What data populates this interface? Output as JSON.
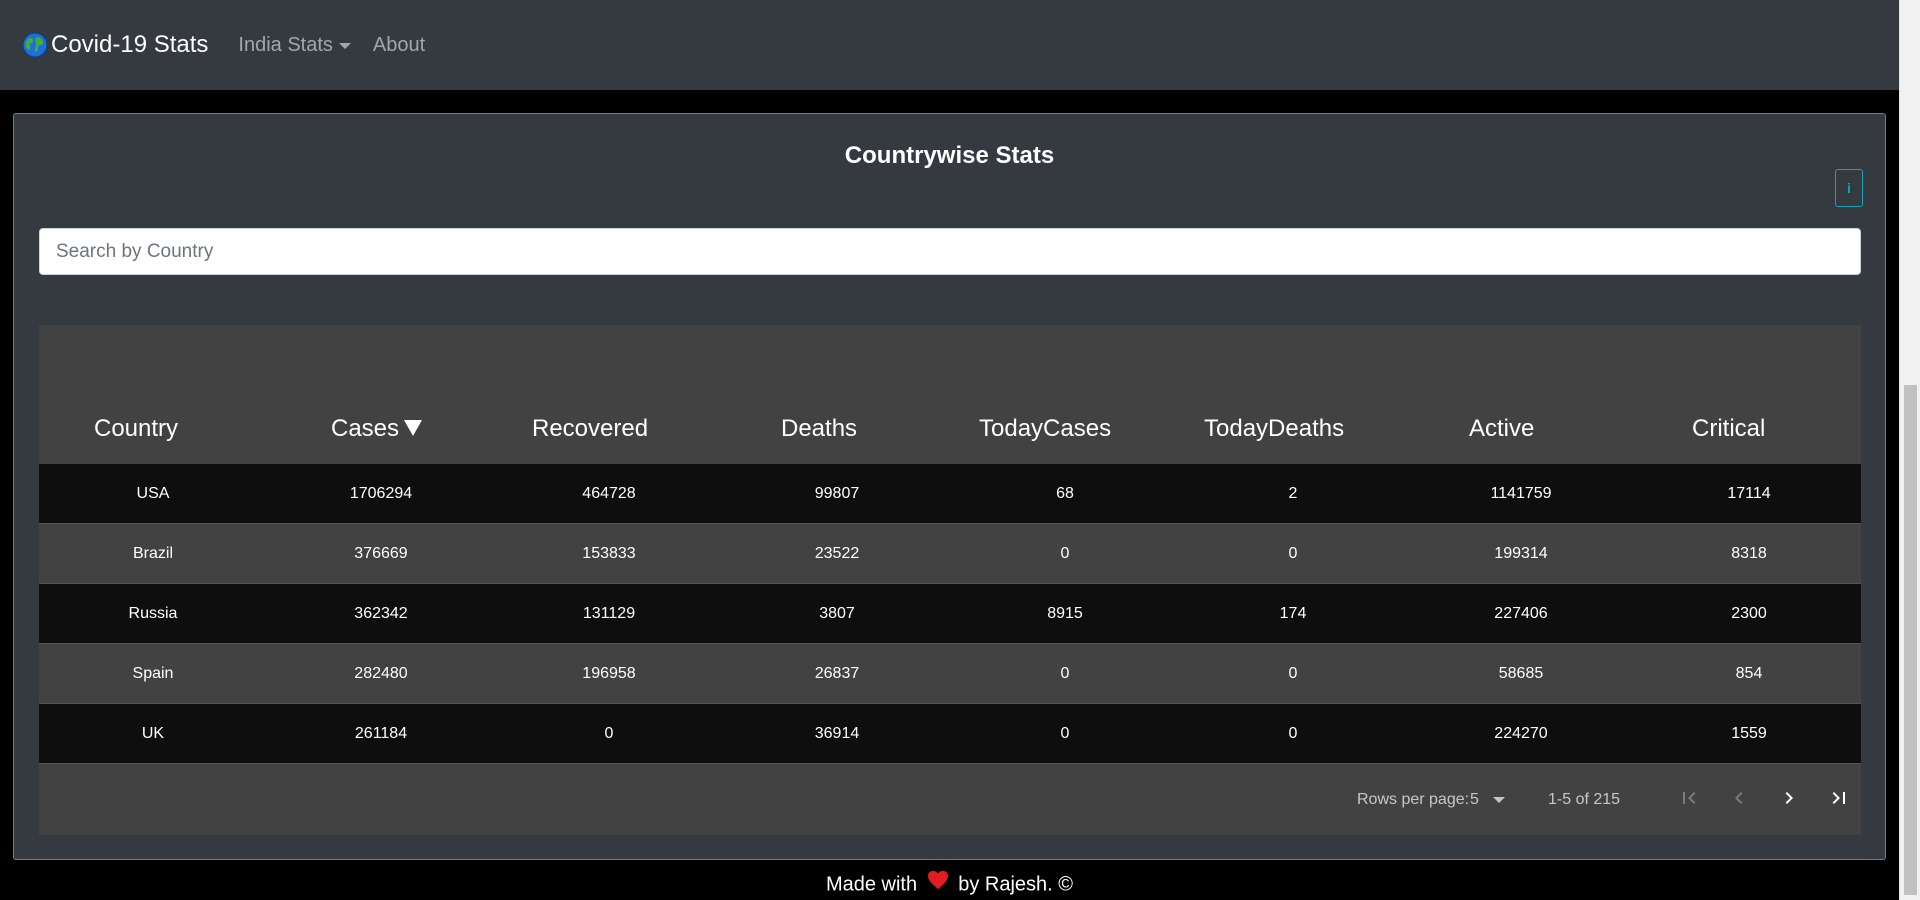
{
  "navbar": {
    "brand": "Covid-19 Stats",
    "brand_icon": "globe-icon",
    "links": [
      {
        "label": "India Stats",
        "dropdown": true
      },
      {
        "label": "About",
        "dropdown": false
      }
    ]
  },
  "card": {
    "title": "Countrywise Stats",
    "info_button": "i",
    "accent_color": "#17a2b8"
  },
  "search": {
    "placeholder": "Search by Country",
    "value": ""
  },
  "table": {
    "columns": [
      "Country",
      "Cases",
      "Recovered",
      "Deaths",
      "TodayCases",
      "TodayDeaths",
      "Active",
      "Critical"
    ],
    "sorted_column": "Cases",
    "sort_direction": "desc",
    "rows": [
      [
        "USA",
        "1706294",
        "464728",
        "99807",
        "68",
        "2",
        "1141759",
        "17114"
      ],
      [
        "Brazil",
        "376669",
        "153833",
        "23522",
        "0",
        "0",
        "199314",
        "8318"
      ],
      [
        "Russia",
        "362342",
        "131129",
        "3807",
        "8915",
        "174",
        "227406",
        "2300"
      ],
      [
        "Spain",
        "282480",
        "196958",
        "26837",
        "0",
        "0",
        "58685",
        "854"
      ],
      [
        "UK",
        "261184",
        "0",
        "36914",
        "0",
        "0",
        "224270",
        "1559"
      ]
    ]
  },
  "pagination": {
    "rows_per_page_label": "Rows per page:",
    "rows_per_page": "5",
    "range": "1-5 of 215",
    "buttons": [
      "first-page-icon",
      "previous-page-icon",
      "next-page-icon",
      "last-page-icon"
    ]
  },
  "footer": {
    "prefix": "Made with",
    "suffix": "by Rajesh. ©",
    "heart_color": "#e31b23"
  }
}
